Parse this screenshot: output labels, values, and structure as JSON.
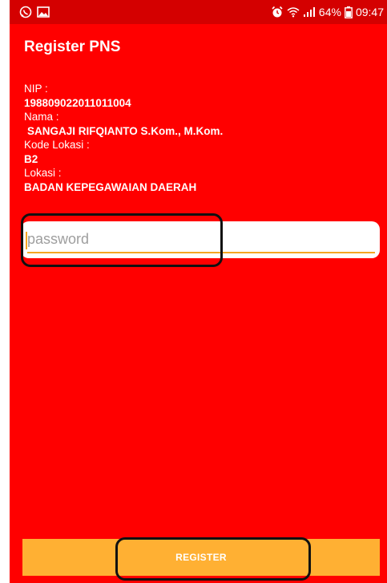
{
  "status_bar": {
    "battery": "64%",
    "time": "09:47",
    "icons": [
      "whatsapp-icon",
      "image-icon",
      "alarm-icon",
      "wifi-icon",
      "signal-icon",
      "battery-icon"
    ]
  },
  "title": "Register PNS",
  "profile": {
    "nip_label": "NIP :",
    "nip_value": "198809022011011004",
    "nama_label": "Nama :",
    "nama_value": "SANGAJI RIFQIANTO S.Kom., M.Kom.",
    "kode_lokasi_label": "Kode Lokasi :",
    "kode_lokasi_value": "B2",
    "lokasi_label": "Lokasi :",
    "lokasi_value": "BADAN KEPEGAWAIAN DAERAH"
  },
  "password": {
    "placeholder": "password",
    "value": ""
  },
  "register_button": {
    "label": "REGISTER"
  },
  "colors": {
    "background": "#ff0000",
    "status_bar": "#d40000",
    "button": "#ffb033",
    "accent": "#f5a623",
    "text": "#ffffff"
  }
}
